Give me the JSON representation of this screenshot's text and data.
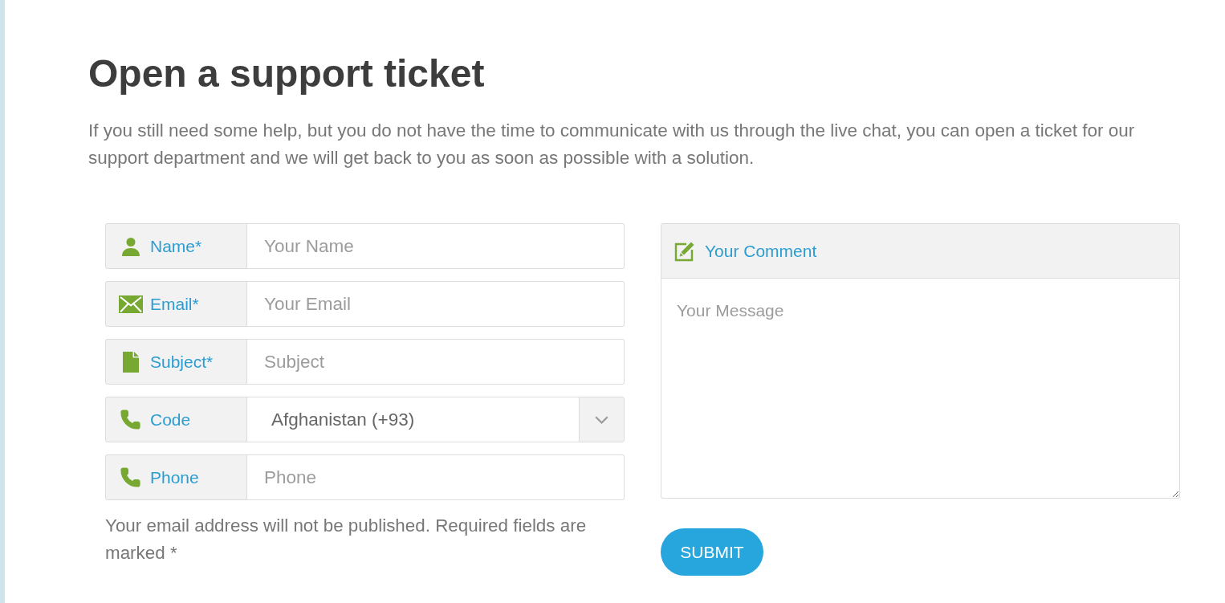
{
  "heading": "Open a support ticket",
  "intro": "If you still need some help, but you do not have the time to communicate with us through the live chat, you can open a ticket for our support department and we will get back to you as soon as possible with a solution.",
  "form": {
    "fields": [
      {
        "kind": "text",
        "label": "Name*",
        "placeholder": "Your Name"
      },
      {
        "kind": "text",
        "label": "Email*",
        "placeholder": "Your Email"
      },
      {
        "kind": "text",
        "label": "Subject*",
        "placeholder": "Subject"
      },
      {
        "kind": "select",
        "label": "Code",
        "value": "Afghanistan (+93)"
      },
      {
        "kind": "text",
        "label": "Phone",
        "placeholder": "Phone"
      }
    ],
    "note": "Your email address will not be published. Required fields are marked *",
    "comment": {
      "label": "Your Comment",
      "placeholder": "Your Message"
    },
    "submit": "SUBMIT"
  }
}
